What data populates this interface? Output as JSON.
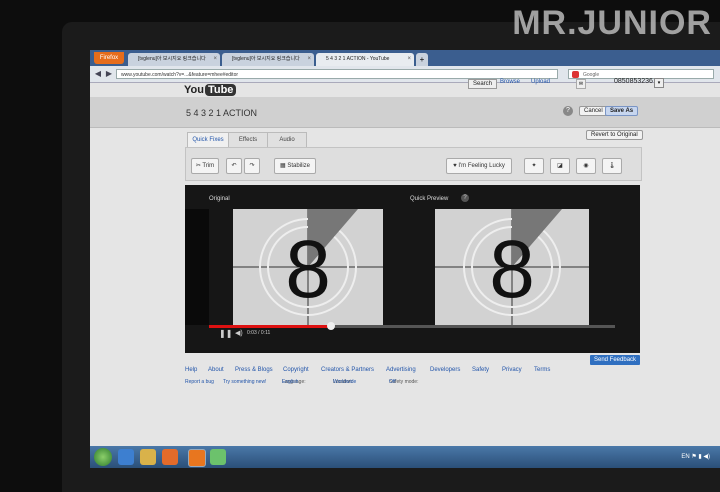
{
  "watermark": "MR.JUNIOR",
  "browser": {
    "app_button": "Firefox",
    "tabs": [
      {
        "label": "[tvglenu]아 보시지요 링크습니다",
        "active": false
      },
      {
        "label": "[tvglenu]아 보시지요 링크습니다",
        "active": false
      },
      {
        "label": "5 4 3 2 1 ACTION - YouTube",
        "active": true
      }
    ],
    "new_tab": "+",
    "url": "www.youtube.com/watch?v=...&feature=mhee#editor",
    "search_placeholder": "Google"
  },
  "youtube": {
    "logo_text": "You",
    "logo_badge": "Tube",
    "search_button": "Search",
    "browse_link": "Browse",
    "upload_link": "Upload",
    "account": "0850853236",
    "account_dropdown": "▾",
    "video_title": "5 4 3 2 1 ACTION",
    "help_glyph": "?",
    "cancel_button": "Cancel",
    "save_as_button": "Save As",
    "revert_button": "Revert to Original",
    "editor_tabs": [
      "Quick Fixes",
      "Effects",
      "Audio"
    ],
    "tools": {
      "trim": "Trim",
      "stabilize": "Stabilize",
      "feeling_lucky": "I'm Feeling Lucky"
    },
    "player": {
      "original_label": "Original",
      "preview_label": "Quick Preview",
      "countdown_digit": "8",
      "time_current": "0:03",
      "time_total": "0:11",
      "progress": 0.3
    },
    "send_feedback": "Send Feedback",
    "footer_links": [
      "Help",
      "About",
      "Press & Blogs",
      "Copyright",
      "Creators & Partners",
      "Advertising",
      "Developers",
      "Safety",
      "Privacy",
      "Terms"
    ],
    "footer_secondary": {
      "report_bug": "Report a bug",
      "try_new": "Try something new!",
      "language_label": "Language:",
      "language_value": "English",
      "location_label": "Location:",
      "location_value": "Worldwide",
      "safety_label": "Safety mode:",
      "safety_value": "Off"
    }
  },
  "taskbar": {
    "tray_lang": "EN"
  }
}
